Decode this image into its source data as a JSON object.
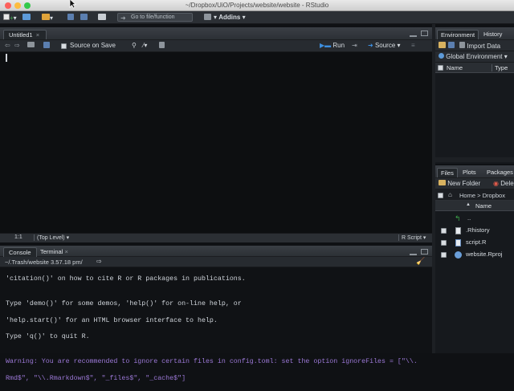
{
  "window": {
    "title": "~/Dropbox/UiO/Projects/website/website - RStudio"
  },
  "toolbar": {
    "goto_placeholder": "Go to file/function",
    "addins_label": "Addins"
  },
  "source_pane": {
    "tab_label": "Untitled1",
    "source_on_save_label": "Source on Save",
    "run_label": "Run",
    "source_label": "Source",
    "cursor_pos": "1:1",
    "scope": "(Top Level)",
    "file_type": "R Script"
  },
  "console_pane": {
    "tabs": [
      "Console",
      "Terminal"
    ],
    "path": "~/.Trash/website 3.57.18 pm/",
    "lines": [
      "'citation()' on how to cite R or R packages in publications.",
      "",
      "Type 'demo()' for some demos, 'help()' for on-line help, or",
      "'help.start()' for an HTML browser interface to help.",
      "Type 'q()' to quit R.",
      ""
    ],
    "warning_lines": [
      "Warning: You are recommended to ignore certain files in config.toml: set the option ignoreFiles = [\"\\\\.",
      "Rmd$\", \"\\\\.Rmarkdown$\", \"_files$\", \"_cache$\"]"
    ]
  },
  "env_pane": {
    "tabs": [
      "Environment",
      "History"
    ],
    "import_label": "Import Data",
    "global_env_label": "Global Environment",
    "col_name": "Name",
    "col_type": "Type"
  },
  "files_pane": {
    "tabs": [
      "Files",
      "Plots",
      "Packages"
    ],
    "new_folder_label": "New Folder",
    "delete_label": "Dele",
    "breadcrumb_home": "Home",
    "breadcrumb_sep": ">",
    "breadcrumb_dir": "Dropbox",
    "col_name": "Name",
    "col_sort": "▲",
    "files": [
      ".. ",
      ".Rhistory",
      "script.R",
      "website.Rproj"
    ]
  },
  "colors": {
    "accent_blue": "#3d8fe0",
    "warning_purple": "#9b78d6",
    "close_red": "#fc605c",
    "min_yellow": "#fdbc40",
    "max_green": "#34c84a"
  }
}
